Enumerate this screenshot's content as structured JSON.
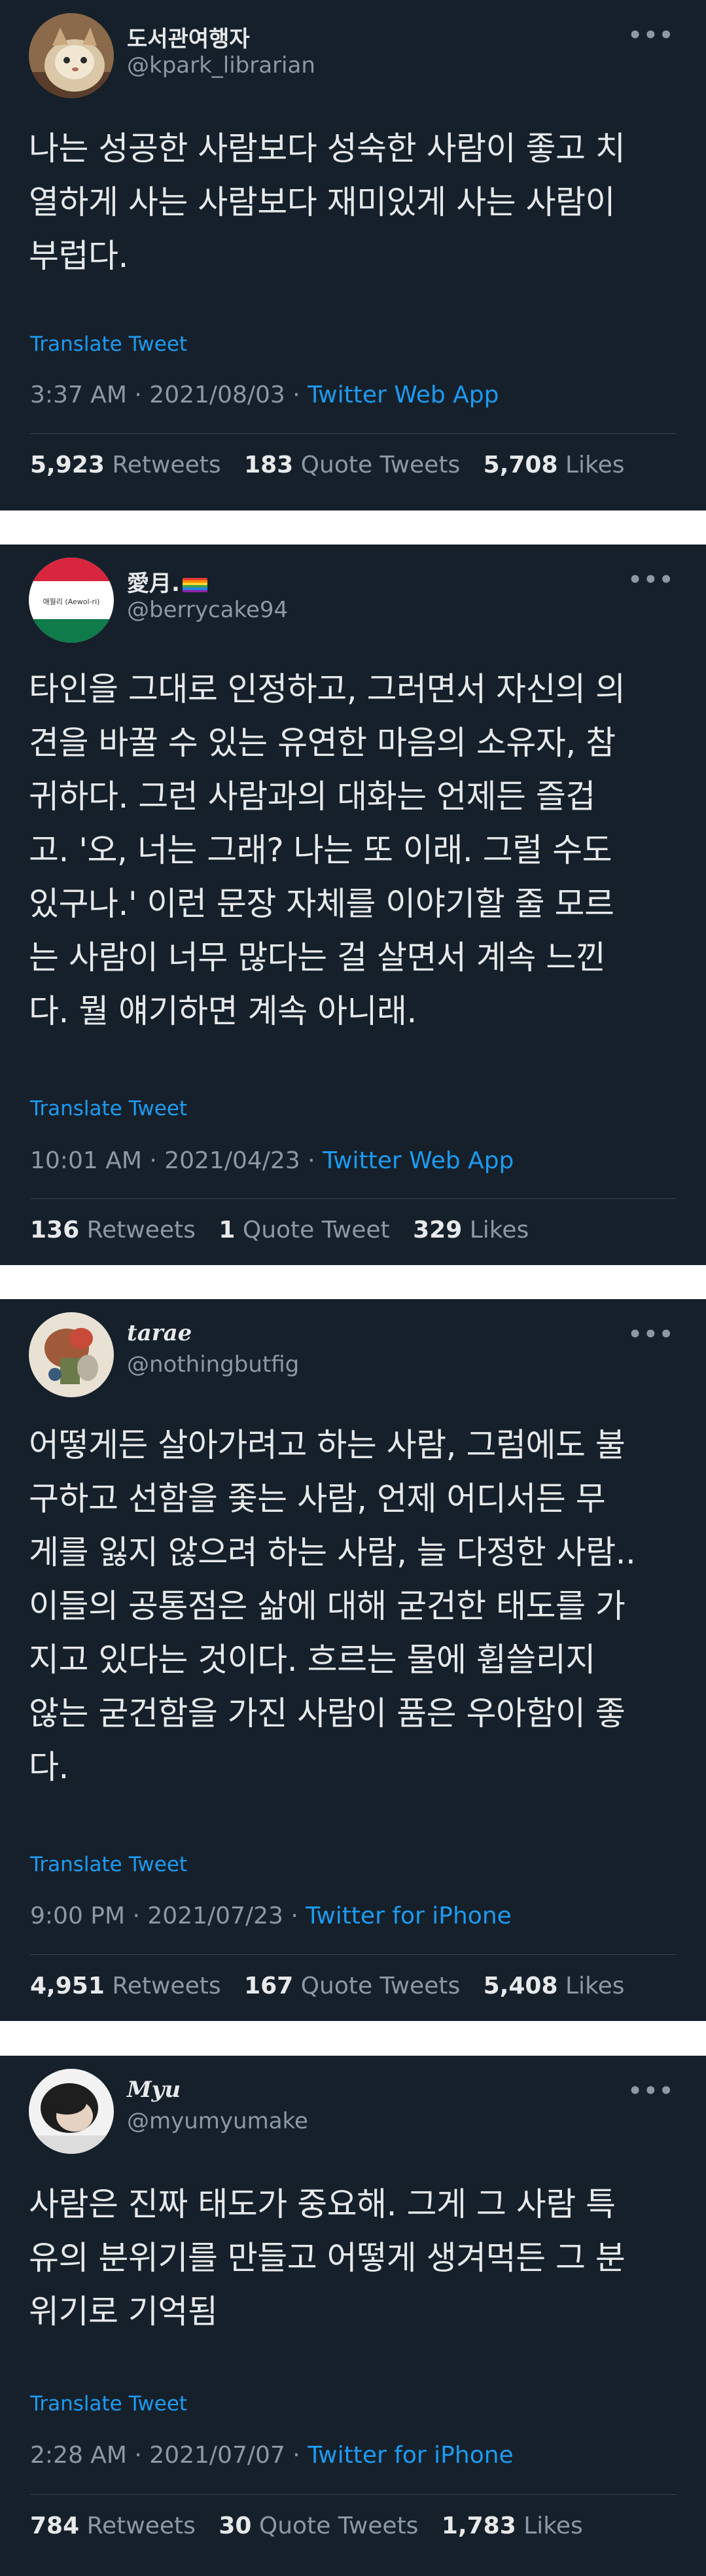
{
  "tweets": [
    {
      "name": "도서관여행자",
      "handle": "@kpark_librarian",
      "text": "나는 성공한 사람보다 성숙한 사람이 좋고 치\n열하게 사는 사람보다 재미있게 사는 사람이\n부럽다.",
      "translate": "Translate Tweet",
      "time": "3:37 AM · 2021/08/03 · ",
      "app": "Twitter Web App",
      "retweets": "5,923",
      "retweets_label": "Retweets",
      "quotes": "183",
      "quotes_label": "Quote Tweets",
      "likes": "5,708",
      "likes_label": "Likes"
    },
    {
      "name": "愛月.",
      "handle": "@berrycake94",
      "avatar_text": "애월리 (Aewol-ri)",
      "text": "타인을 그대로 인정하고, 그러면서 자신의 의\n견을 바꿀 수 있는 유연한 마음의 소유자, 참\n귀하다. 그런 사람과의 대화는 언제든 즐겁\n고. '오, 너는 그래? 나는 또 이래. 그럴 수도\n있구나.' 이런 문장 자체를 이야기할 줄 모르\n는 사람이 너무 많다는 걸 살면서 계속 느낀\n다. 뭘 얘기하면 계속 아니래.",
      "translate": "Translate Tweet",
      "time": "10:01 AM · 2021/04/23 · ",
      "app": "Twitter Web App",
      "retweets": "136",
      "retweets_label": "Retweets",
      "quotes": "1",
      "quotes_label": "Quote Tweet",
      "likes": "329",
      "likes_label": "Likes"
    },
    {
      "name": "tarae",
      "handle": "@nothingbutfig",
      "text": "어떻게든 살아가려고 하는 사람, 그럼에도 불\n구하고 선함을 좇는 사람, 언제 어디서든 무\n게를 잃지 않으려 하는 사람, 늘 다정한 사람..\n이들의 공통점은 삶에 대해 굳건한 태도를 가\n지고 있다는 것이다. 흐르는 물에 휩쓸리지\n않는 굳건함을 가진 사람이 품은 우아함이 좋\n다.",
      "translate": "Translate Tweet",
      "time": "9:00 PM · 2021/07/23 · ",
      "app": "Twitter for iPhone",
      "retweets": "4,951",
      "retweets_label": "Retweets",
      "quotes": "167",
      "quotes_label": "Quote Tweets",
      "likes": "5,408",
      "likes_label": "Likes"
    },
    {
      "name": "Myu",
      "handle": "@myumyumake",
      "text": "사람은 진짜 태도가 중요해. 그게 그 사람 특\n유의 분위기를 만들고 어떻게 생겨먹든 그 분\n위기로 기억됨",
      "translate": "Translate Tweet",
      "time": "2:28 AM · 2021/07/07 · ",
      "app": "Twitter for iPhone",
      "retweets": "784",
      "retweets_label": "Retweets",
      "quotes": "30",
      "quotes_label": "Quote Tweets",
      "likes": "1,783",
      "likes_label": "Likes"
    }
  ],
  "more_icon": "more-horizontal-icon",
  "colors": {
    "background": "#15202b",
    "text": "#e7e9ea",
    "secondary": "#8b98a5",
    "link": "#1d9bf0",
    "divider": "#38444d",
    "separator": "#ffffff"
  }
}
